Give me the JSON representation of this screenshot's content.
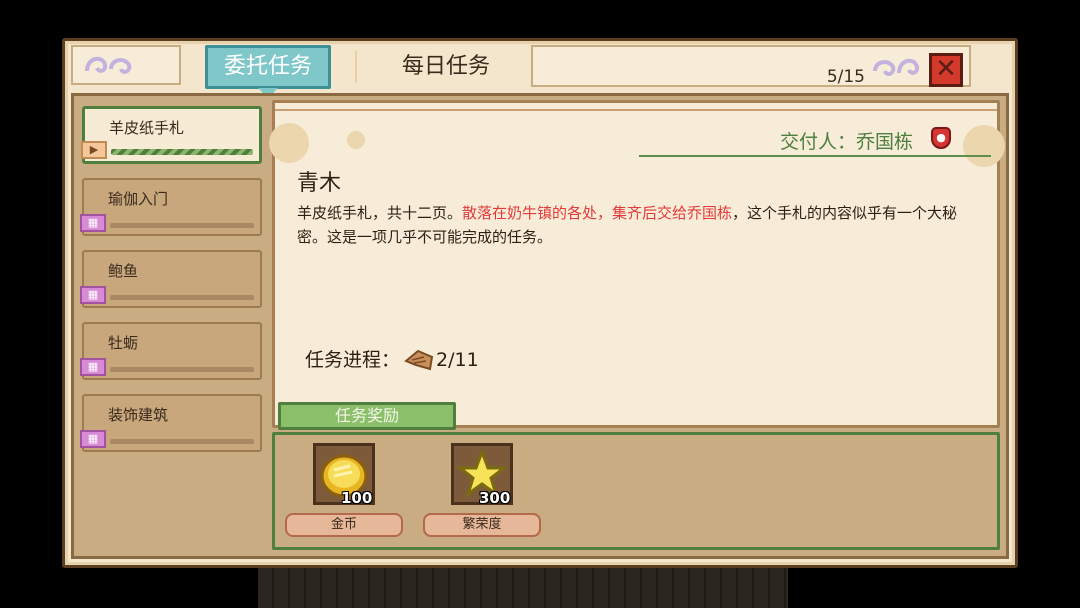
{
  "header": {
    "tab_active": "委托任务",
    "tab_inactive": "每日任务",
    "quest_count": "5/15",
    "close_symbol": "✕"
  },
  "quest_list": [
    {
      "label": "羊皮纸手札",
      "selected": true
    },
    {
      "label": "瑜伽入门",
      "selected": false
    },
    {
      "label": "鲍鱼",
      "selected": false
    },
    {
      "label": "牡蛎",
      "selected": false
    },
    {
      "label": "装饰建筑",
      "selected": false
    }
  ],
  "detail": {
    "giver_label": "交付人：乔国栋",
    "title": "青木",
    "desc_part1": "羊皮纸手札，共十二页。",
    "desc_red": "散落在奶牛镇的各处，集齐后交给乔国栋",
    "desc_part2": "，这个手札的内容似乎有一个大秘密。这是一项几乎不可能完成的任务。",
    "progress_label": "任务进程：",
    "progress_value": "2/11",
    "progress_icon": "parchment-icon"
  },
  "rewards": {
    "tab_label": "任务奖励",
    "items": [
      {
        "name": "金币",
        "amount": "100",
        "icon": "gold-coin-icon"
      },
      {
        "name": "繁荣度",
        "amount": "300",
        "icon": "star-icon"
      }
    ]
  },
  "colors": {
    "accent_teal": "#7fc7c9",
    "accent_green": "#4f7f3e",
    "highlight_red": "#e23a3a",
    "close_red": "#d33a2c"
  }
}
